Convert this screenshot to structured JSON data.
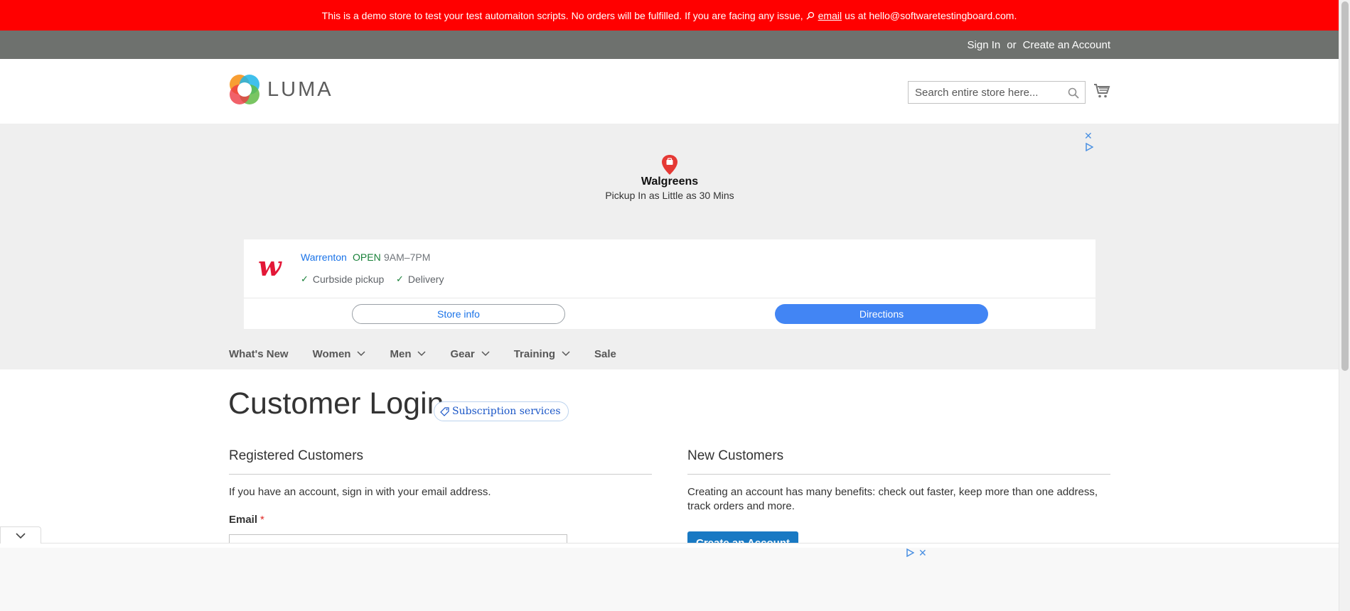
{
  "notice": {
    "text_before": "This is a demo store to test your test automaiton scripts. No orders will be fulfilled. If you are facing any issue,",
    "email_link": "email",
    "text_after": "us at hello@softwaretestingboard.com."
  },
  "header": {
    "sign_in": "Sign In",
    "or": "or",
    "create_account": "Create an Account",
    "logo_text": "LUMA",
    "search_placeholder": "Search entire store here..."
  },
  "ad": {
    "brand": "Walgreens",
    "tagline": "Pickup In as Little as 30 Mins",
    "logo_letter": "w",
    "store_city": "Warrenton",
    "store_status": "OPEN",
    "store_hours": "9AM–7PM",
    "feature_1": "Curbside pickup",
    "feature_2": "Delivery",
    "store_info_label": "Store info",
    "directions_label": "Directions"
  },
  "nav": {
    "items": [
      {
        "label": "What's New"
      },
      {
        "label": "Women"
      },
      {
        "label": "Men"
      },
      {
        "label": "Gear"
      },
      {
        "label": "Training"
      },
      {
        "label": "Sale"
      }
    ]
  },
  "main": {
    "title": "Customer Login",
    "badge": "Subscription services",
    "registered": {
      "heading": "Registered Customers",
      "text": "If you have an account, sign in with your email address.",
      "email_label": "Email",
      "required_mark": "*"
    },
    "new_customers": {
      "heading": "New Customers",
      "text_line1": "Creating an account has many benefits: check out faster, keep more than one address,",
      "text_line2": "track orders and more.",
      "button": "Create an Account"
    }
  },
  "colors": {
    "notice_bg": "#ff0000",
    "header_bar": "#6e716e",
    "primary_button": "#1979c3",
    "directions_button": "#4285f4",
    "walgreens_red": "#e31837",
    "open_green": "#188038"
  }
}
